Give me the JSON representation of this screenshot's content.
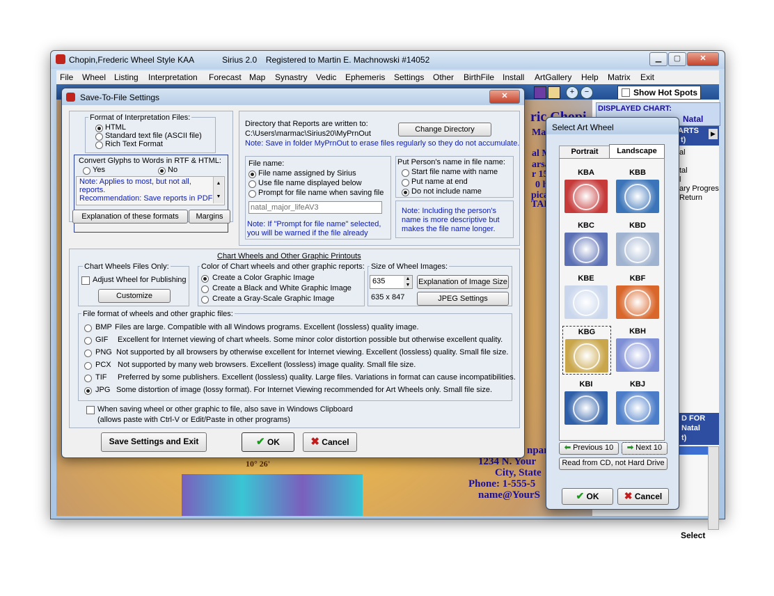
{
  "app": {
    "title": "Chopin,Frederic Wheel Style KAA",
    "version": "Sirius 2.0",
    "registration": "Registered to Martin E. Machnowski #14052"
  },
  "menu": [
    "File",
    "Wheel",
    "Listing",
    "Interpretation",
    "Forecast",
    "Map",
    "Synastry",
    "Vedic",
    "Ephemeris",
    "Settings",
    "Other",
    "BirthFile",
    "Install",
    "ArtGallery",
    "Help",
    "Matrix",
    "Exit"
  ],
  "toolbar": {
    "show_hot_spots": "Show Hot Spots",
    "displayed_chart": "DISPLAYED CHART:",
    "natal": "Natal",
    "arts": "ARTS",
    "t": "t)"
  },
  "background": {
    "chart_name": "ric Chopi",
    "march": "Marc",
    "line_m": "al M",
    "line_arsa": "arsa",
    "line_15": "r 15",
    "line_0ho": "0 ho",
    "line_pica": "pica",
    "line_tal": "TAL",
    "degree": "10° 26'",
    "company": "npar",
    "address": "1234 N. Your",
    "city": "City, State",
    "phone": "Phone: 1-555-5",
    "email": "name@YourS",
    "right_list": [
      "al",
      "tal",
      "l",
      "ary Progres",
      "Return"
    ],
    "right_d_for": "D FOR",
    "right_natal": "Natal",
    "right_t": "t)",
    "right_select": "Select"
  },
  "save_dialog": {
    "title": "Save-To-File Settings",
    "format_group": "Format of Interpretation Files:",
    "formats": [
      "HTML",
      "Standard text file (ASCII file)",
      "Rich Text Format"
    ],
    "convert_group": "Convert Glyphs to Words in RTF & HTML:",
    "yes": "Yes",
    "no": "No",
    "note_box": [
      "Note: Applies to most, but not all,",
      "reports.",
      "Recommendation: Save reports in PDF"
    ],
    "explanation_button": "Explanation of these formats",
    "margins_button": "Margins",
    "directory_label": "Directory that Reports are written to:",
    "directory_path": "C:\\Users\\marmac\\Sirius20\\MyPrnOut",
    "change_directory": "Change Directory",
    "directory_note": "Note: Save in folder MyPrnOut to erase files regularly so they do not accumulate.",
    "file_name_group": "File name:",
    "file_name_options": [
      "File name assigned by Sirius",
      "Use file name displayed below",
      "Prompt for file name when saving file"
    ],
    "file_name_value": "natal_major_lifeAV3",
    "file_name_note": [
      "Note: If \"Prompt for file name\" selected,",
      "you will be warned if the file already"
    ],
    "person_group": "Put Person's name in file name:",
    "person_options": [
      "Start file name with name",
      "Put name at end",
      "Do not include name"
    ],
    "person_note": [
      "Note: Including the person's",
      "name is more descriptive but",
      "makes the file name longer."
    ],
    "graphic_group": "Chart Wheels and Other Graphic Printouts",
    "chart_wheels_only": "Chart Wheels Files Only:",
    "adjust_wheel": "Adjust Wheel for Publishing",
    "customize": "Customize",
    "color_group": "Color of Chart wheels and other graphic reports:",
    "color_options": [
      "Create a Color Graphic Image",
      "Create a Black and White Graphic Image",
      "Create a Gray-Scale Graphic Image"
    ],
    "size_group": "Size of Wheel Images:",
    "size_value": "635",
    "size_dims": "635 x 847",
    "explain_size": "Explanation of Image Size",
    "jpeg_settings": "JPEG Settings",
    "file_format_group": "File format of wheels and other graphic files:",
    "file_formats": [
      {
        "ext": "BMP",
        "desc": "Files are large. Compatible with all Windows programs. Excellent (lossless) quality image."
      },
      {
        "ext": "GIF",
        "desc": "Excellent for Internet viewing of chart wheels. Some minor color distortion possible but otherwise excellent quality."
      },
      {
        "ext": "PNG",
        "desc": "Not supported by all browsers by otherwise excellent for Internet viewing. Excellent (lossless) quality. Small file size."
      },
      {
        "ext": "PCX",
        "desc": "Not supported by many web browsers. Excellent (lossless) image quality. Small file size."
      },
      {
        "ext": "TIF",
        "desc": "Preferred by some publishers. Excellent (lossless) quality. Large files. Variations in format can cause incompatibilities."
      },
      {
        "ext": "JPG",
        "desc": "Some distortion of image (lossy format). For Internet Viewing recommended for Art Wheels only. Small file size."
      }
    ],
    "clipboard_check": "When saving wheel or other graphic to file, also save in Windows Clipboard",
    "clipboard_sub": "(allows paste with Ctrl-V or Edit/Paste in other programs)",
    "save_exit": "Save Settings and Exit",
    "ok": "OK",
    "cancel": "Cancel"
  },
  "art_dialog": {
    "title": "Select Art Wheel",
    "tabs": [
      "Portrait",
      "Landscape"
    ],
    "wheels": [
      {
        "name": "KBA",
        "color": "#c63a3a"
      },
      {
        "name": "KBB",
        "color": "#3b74b8"
      },
      {
        "name": "KBC",
        "color": "#5a6fb4"
      },
      {
        "name": "KBD",
        "color": "#9fb2cf"
      },
      {
        "name": "KBE",
        "color": "#c9d6ec"
      },
      {
        "name": "KBF",
        "color": "#d9662a"
      },
      {
        "name": "KBG",
        "color": "#c9a64a"
      },
      {
        "name": "KBH",
        "color": "#7f8fd6"
      },
      {
        "name": "KBI",
        "color": "#2e5fa8"
      },
      {
        "name": "KBJ",
        "color": "#4a7cc8"
      }
    ],
    "previous": "Previous 10",
    "next": "Next 10",
    "read_cd": "Read from CD, not Hard Drive",
    "ok": "OK",
    "cancel": "Cancel"
  }
}
